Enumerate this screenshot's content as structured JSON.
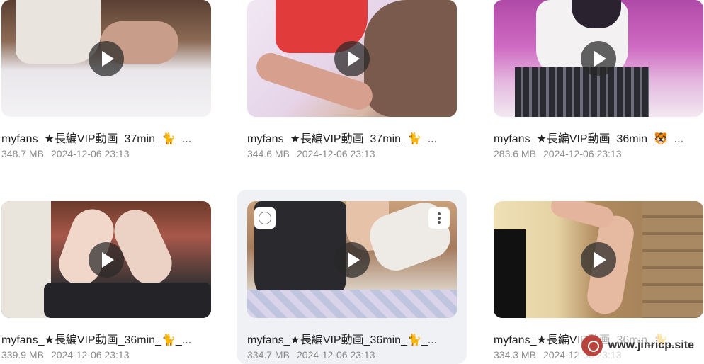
{
  "videos": [
    {
      "title": "myfans_★長編VIP動画_37min_🐈_...",
      "size": "348.7 MB",
      "date": "2024-12-06 23:13"
    },
    {
      "title": "myfans_★長編VIP動画_37min_🐈_...",
      "size": "344.6 MB",
      "date": "2024-12-06 23:13"
    },
    {
      "title": "myfans_★長編VIP動画_36min_🐯_...",
      "size": "283.6 MB",
      "date": "2024-12-06 23:13"
    },
    {
      "title": "myfans_★長編VIP動画_36min_🐈_...",
      "size": "339.9 MB",
      "date": "2024-12-06 23:13"
    },
    {
      "title": "myfans_★長編VIP動画_36min_🐈_...",
      "size": "334.7 MB",
      "date": "2024-12-06 23:13"
    },
    {
      "title": "myfans_★長編VIP動画_36min_🐈_...",
      "size": "334.3 MB",
      "date": "2024-12-06 23:13"
    }
  ],
  "watermark": {
    "text": "www.jinricp.site"
  },
  "icons": {
    "play": "play-icon",
    "checkbox": "select-checkbox",
    "menu": "more-vertical-icon"
  }
}
